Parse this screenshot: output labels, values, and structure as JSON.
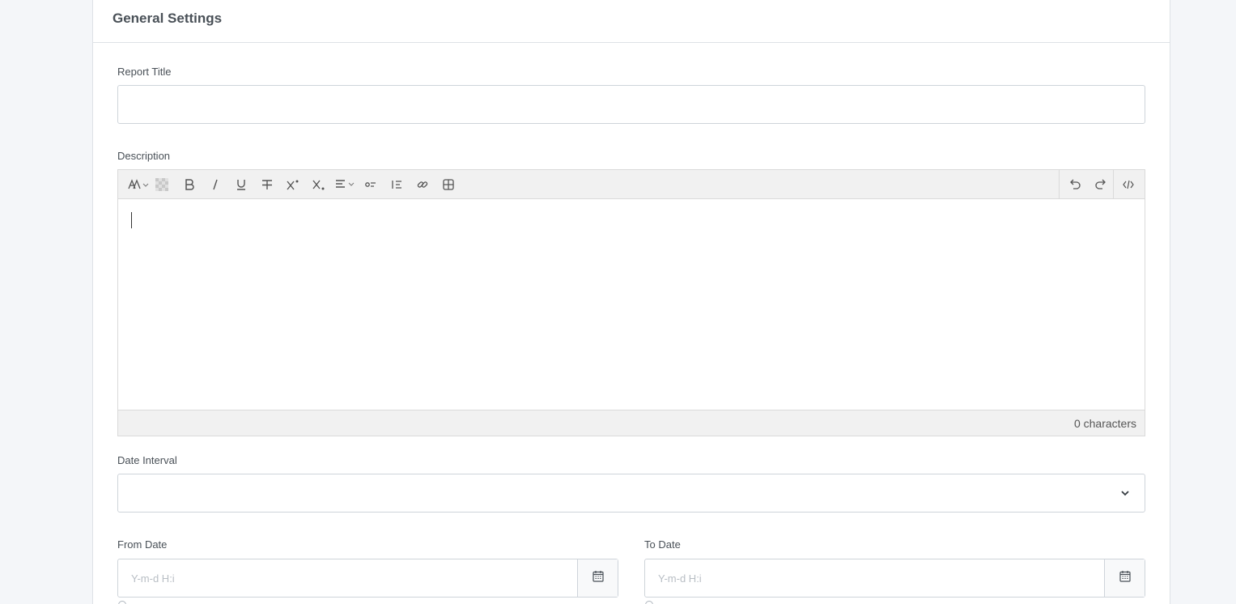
{
  "card": {
    "title": "General Settings"
  },
  "form": {
    "report_title": {
      "label": "Report Title",
      "value": ""
    },
    "description": {
      "label": "Description",
      "char_count": "0 characters",
      "toolbar_left": [
        "font-size-icon",
        "color-picker-icon",
        "bold-icon",
        "italic-icon",
        "underline-icon",
        "strikethrough-icon",
        "superscript-icon",
        "subscript-icon",
        "align-icon",
        "bullet-list-icon",
        "numbered-list-icon",
        "link-icon",
        "table-icon"
      ],
      "toolbar_right": [
        "undo-icon",
        "redo-icon",
        "code-view-icon"
      ]
    },
    "date_interval": {
      "label": "Date Interval",
      "value": ""
    },
    "from_date": {
      "label": "From Date",
      "placeholder": "Y-m-d H:i"
    },
    "to_date": {
      "label": "To Date",
      "placeholder": "Y-m-d H:i"
    }
  }
}
